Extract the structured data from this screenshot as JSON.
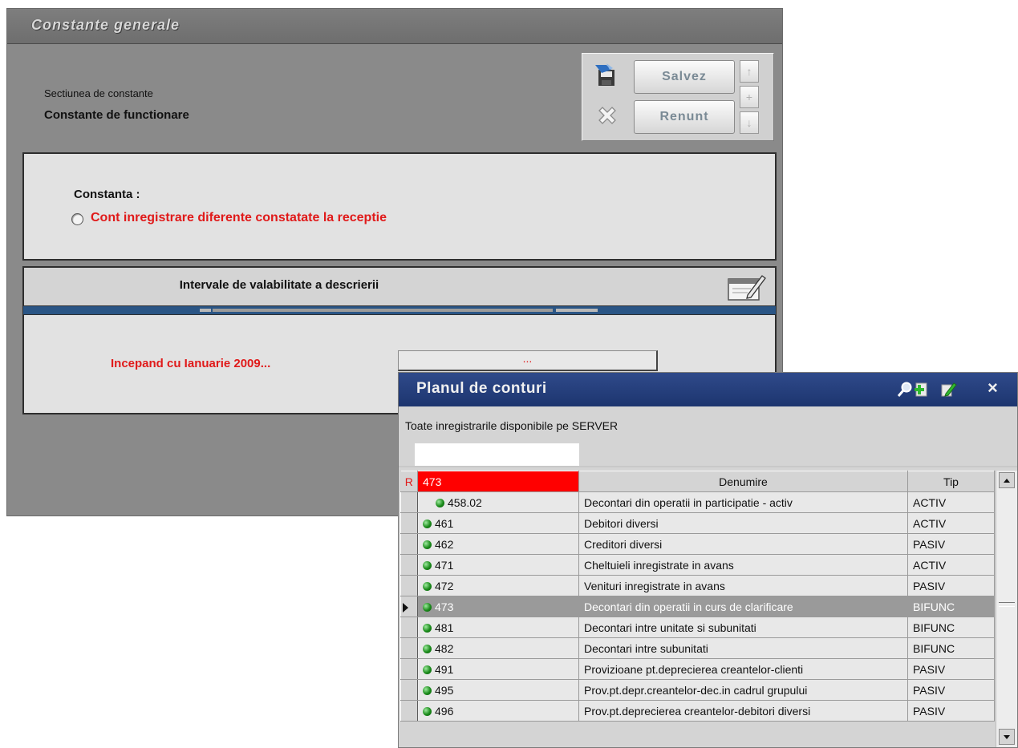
{
  "main": {
    "title": "Constante generale",
    "section_label": "Sectiunea de constante",
    "section_value": "Constante de functionare",
    "save_label": "Salvez",
    "cancel_label": "Renunt",
    "constant_label": "Constanta :",
    "constant_value": "Cont inregistrare diferente constatate la receptie",
    "interval_title": "Intervale de valabilitate a descrierii",
    "interval_start": "Incepand cu Ianuarie 2009...",
    "interval_field": "..."
  },
  "coa": {
    "title": "Planul de conturi",
    "status": "Toate inregistrarile disponibile pe SERVER",
    "filter_value": "",
    "columns": {
      "r": "R",
      "code": "473",
      "name": "Denumire",
      "type": "Tip"
    },
    "rows": [
      {
        "code": "458.02",
        "name": "Decontari din operatii in participatie - activ",
        "type": "ACTIV"
      },
      {
        "code": "461",
        "name": "Debitori diversi",
        "type": "ACTIV"
      },
      {
        "code": "462",
        "name": "Creditori diversi",
        "type": "PASIV"
      },
      {
        "code": "471",
        "name": "Cheltuieli inregistrate in avans",
        "type": "ACTIV"
      },
      {
        "code": "472",
        "name": "Venituri inregistrate in avans",
        "type": "PASIV"
      },
      {
        "code": "473",
        "name": "Decontari din operatii in curs de clarificare",
        "type": "BIFUNC"
      },
      {
        "code": "481",
        "name": "Decontari intre unitate si subunitati",
        "type": "BIFUNC"
      },
      {
        "code": "482",
        "name": "Decontari intre subunitati",
        "type": "BIFUNC"
      },
      {
        "code": "491",
        "name": "Provizioane pt.deprecierea creantelor-clienti",
        "type": "PASIV"
      },
      {
        "code": "495",
        "name": "Prov.pt.depr.creantelor-dec.in cadrul grupului",
        "type": "PASIV"
      },
      {
        "code": "496",
        "name": "Prov.pt.deprecierea creantelor-debitori diversi",
        "type": "PASIV"
      }
    ],
    "selected_code": "473"
  },
  "colors": {
    "accent_red": "#e01a1a",
    "title_blue": "#1d356f",
    "status_green": "#1a8a1a"
  },
  "icons": {
    "save": "floppy-save-icon",
    "cancel": "cancel-x-icon",
    "edit": "edit-pencil-icon",
    "search": "search-icon",
    "add": "add-record-icon",
    "close": "close-icon"
  }
}
